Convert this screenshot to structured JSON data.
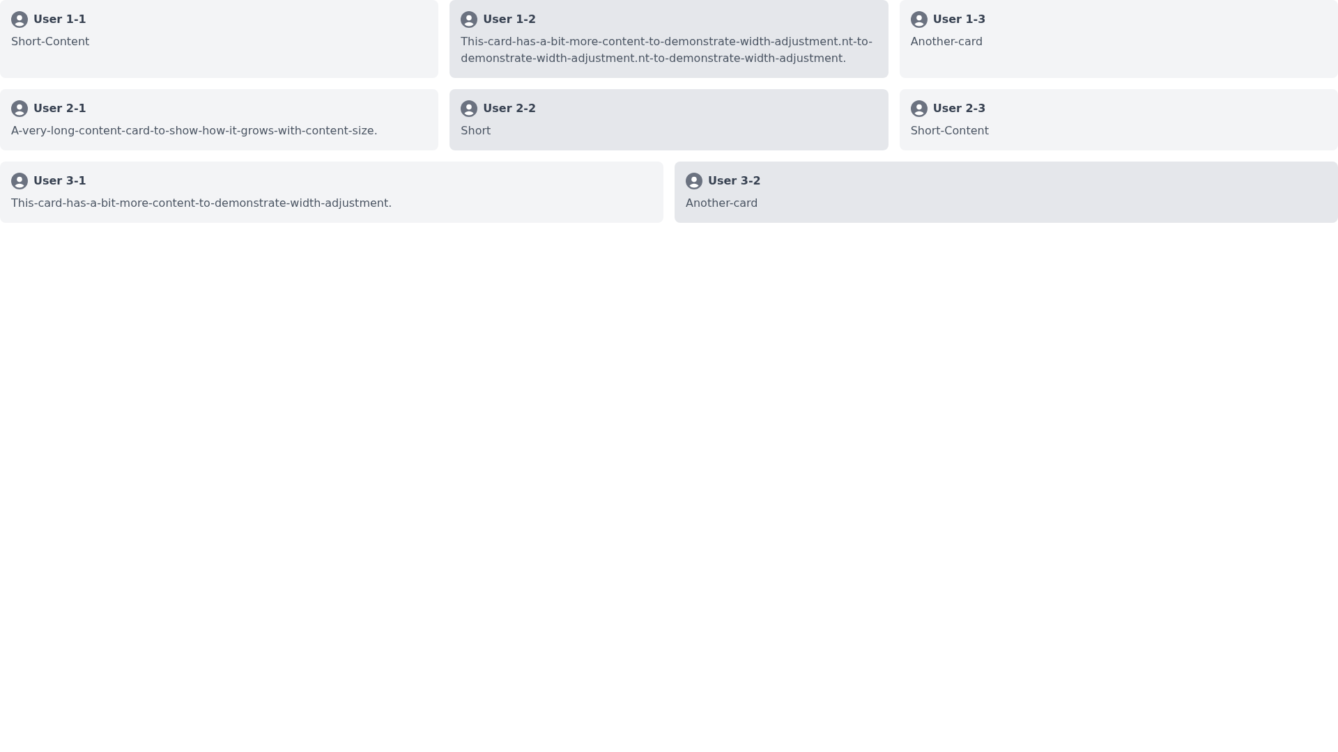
{
  "rows": [
    {
      "cards": [
        {
          "name": "User 1-1",
          "content": "Short-Content"
        },
        {
          "name": "User 1-2",
          "content": "This-card-has-a-bit-more-content-to-demonstrate-width-adjustment.nt-to-demonstrate-width-adjustment.nt-to-demonstrate-width-adjustment."
        },
        {
          "name": "User 1-3",
          "content": "Another-card"
        }
      ]
    },
    {
      "cards": [
        {
          "name": "User 2-1",
          "content": "A-very-long-content-card-to-show-how-it-grows-with-content-size."
        },
        {
          "name": "User 2-2",
          "content": "Short"
        },
        {
          "name": "User 2-3",
          "content": "Short-Content"
        }
      ]
    },
    {
      "cards": [
        {
          "name": "User 3-1",
          "content": "This-card-has-a-bit-more-content-to-demonstrate-width-adjustment."
        },
        {
          "name": "User 3-2",
          "content": "Another-card"
        }
      ]
    }
  ]
}
